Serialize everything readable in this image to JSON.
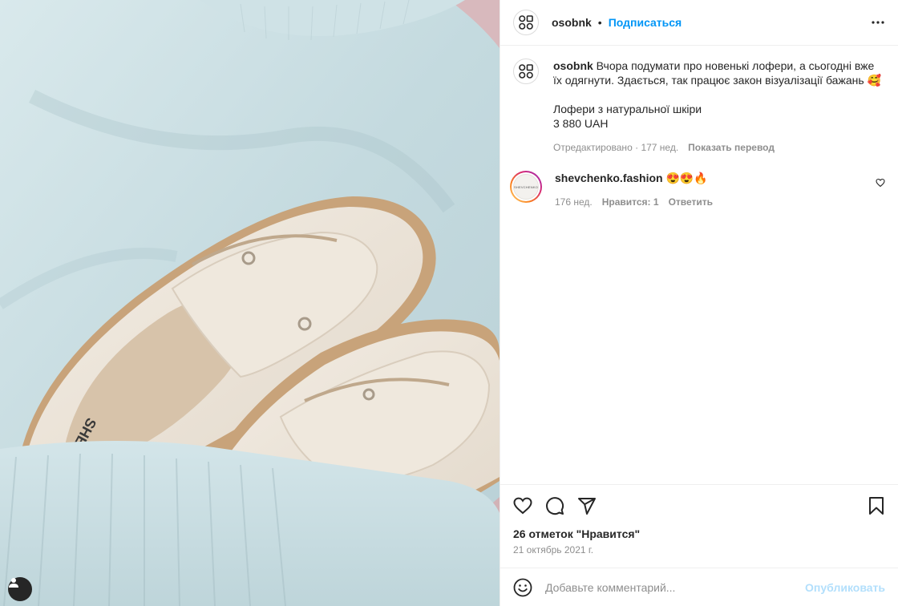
{
  "post": {
    "username": "osobnk",
    "follow_label": "Подписаться",
    "separator": "•",
    "more_icon": "more-horizontal-icon"
  },
  "caption": {
    "username": "osobnk",
    "text": "Вчора подумати про новенькі лофери, а сьогодні вже їх одягнути. Здається, так працює закон візуалізації бажань 🥰\n\nЛофери з натуральної шкіри\n3 880 UAH",
    "edited_label": "Отредактировано",
    "age": "177 нед.",
    "translate_label": "Показать перевод"
  },
  "comment": {
    "username": "shevchenko.fashion",
    "text": "😍😍🔥",
    "avatar_text": "SHEVCHENKO",
    "age": "176 нед.",
    "likes_label": "Нравится: 1",
    "reply_label": "Ответить"
  },
  "actions": {
    "likes_text": "26 отметок \"Нравится\"",
    "date": "21 октябрь 2021 г.",
    "icons": [
      "heart-icon",
      "comment-icon",
      "share-icon",
      "bookmark-icon"
    ]
  },
  "add_comment": {
    "placeholder": "Добавьте комментарий...",
    "value": "",
    "publish_label": "Опубликовать"
  },
  "colors": {
    "accent": "#0095f6",
    "publish_disabled": "#b2dffc",
    "secondary_text": "#8e8e8e",
    "primary_text": "#262626",
    "border": "#efefef"
  }
}
